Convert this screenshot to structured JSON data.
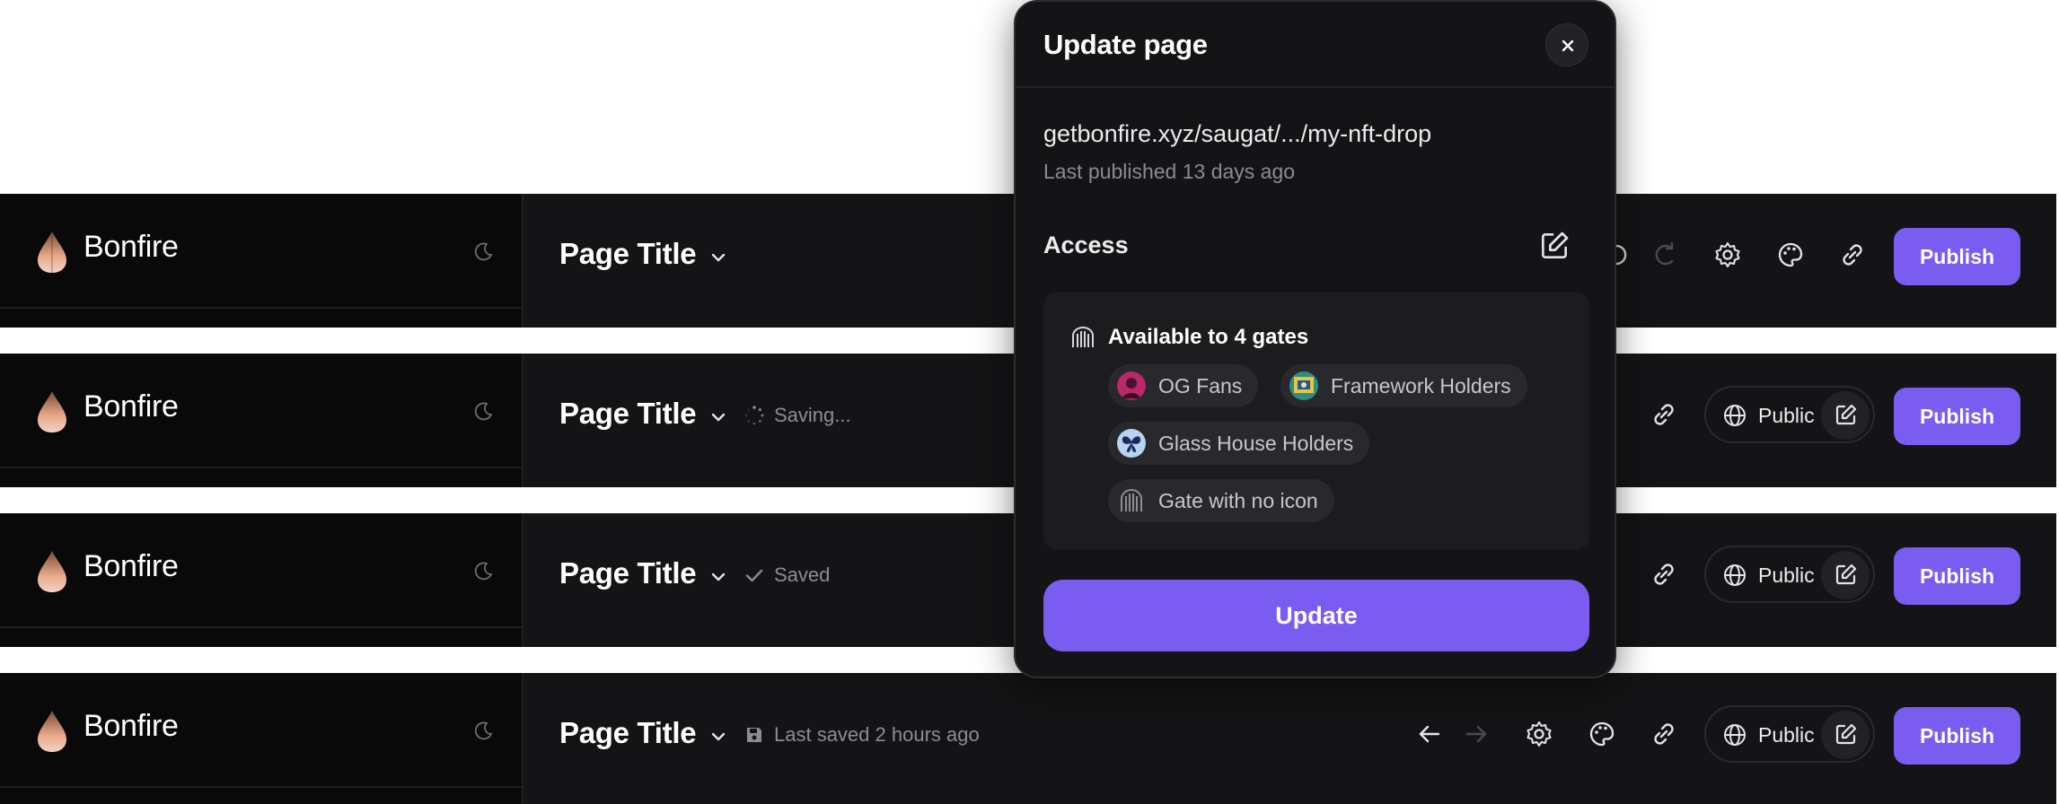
{
  "app": {
    "brand": "Bonfire"
  },
  "colors": {
    "accent": "#7a5cf0",
    "bar_bg": "#141416",
    "sidebar_bg": "#09090a"
  },
  "header": {
    "page_title": "Page Title",
    "publish_label": "Publish",
    "public_label": "Public",
    "statuses": {
      "saving": "Saving...",
      "saved": "Saved",
      "last_saved": "Last saved 2 hours ago"
    },
    "icons": [
      "undo-icon",
      "redo-icon",
      "gear-icon",
      "palette-icon",
      "link-icon",
      "globe-icon",
      "edit-icon",
      "moon-icon"
    ]
  },
  "modal": {
    "title": "Update page",
    "url": "getbonfire.xyz/saugat/.../my-nft-drop",
    "last_published": "Last published 13 days ago",
    "access_label": "Access",
    "gates_title": "Available to 4 gates",
    "gates": [
      {
        "label": "OG Fans",
        "icon": "og-fans-avatar"
      },
      {
        "label": "Framework Holders",
        "icon": "framework-avatar"
      },
      {
        "label": "Glass House Holders",
        "icon": "glass-house-avatar"
      },
      {
        "label": "Gate with no icon",
        "icon": "gate-icon"
      }
    ],
    "update_label": "Update"
  }
}
